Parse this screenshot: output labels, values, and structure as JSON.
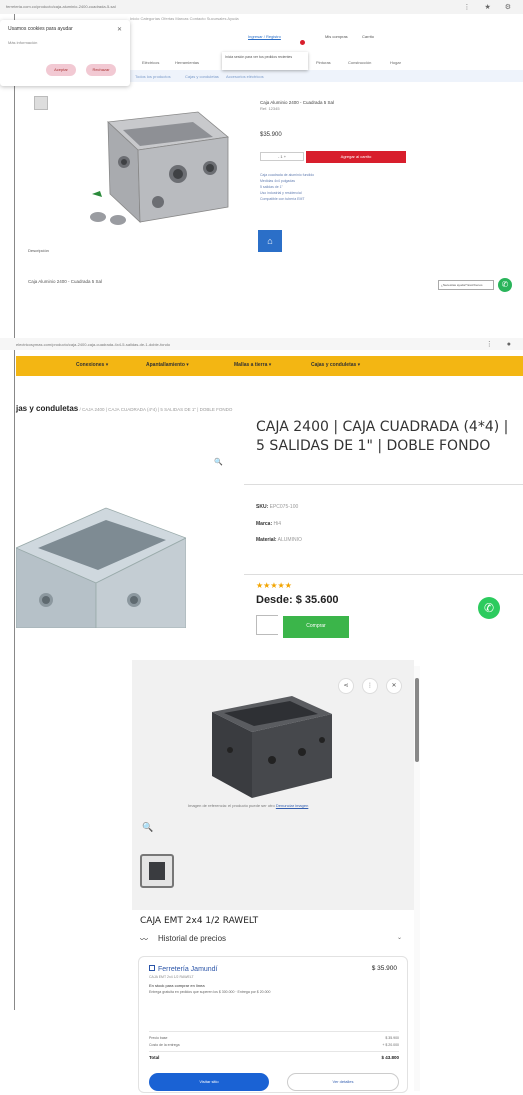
{
  "panel1": {
    "url": "ferreteria.com.co/producto/caja-aluminio-2400-cuadrada-5-sal",
    "window_controls": "⋮ ★ ⚙",
    "tabs": "Inicio   Categorías   Ofertas   Marcas   Contacto   Sucursales   Ayuda",
    "search_placeholder": "Buscar",
    "nav": [
      "Ingresar / Registro",
      "Mis compras",
      "Carrito"
    ],
    "categories": [
      "Eléctricos",
      "Herramientas",
      "Plomería",
      "Pinturas",
      "Construcción",
      "Hogar"
    ],
    "filter_links": [
      "Todos los productos",
      "Cajas y conduletas",
      "Accesorios eléctricos"
    ],
    "cookie": {
      "title": "Usamos cookies para ayudar",
      "sub": "Más información",
      "accept": "Aceptar",
      "reject": "Rechazar"
    },
    "tooltip": "Inicia sesión para ver tus pedidos recientes",
    "product_title": "Caja Aluminio 2400 - Cuadrada 5 Sal",
    "product_sub": "Ref. 12345",
    "price": "$35.900",
    "qty": "-   1   +",
    "add_to_cart": "Agregar al carrito",
    "features": [
      "Caja cuadrada de aluminio fundido",
      "Medidas 4x4 pulgadas",
      "5 salidas de 1\"",
      "Uso industrial y residencial",
      "Compatible con tubería EMT"
    ],
    "home_icon": "⌂",
    "section_label": "Descripción",
    "section_sub": "Caja Aluminio 2400 - Cuadrada 5 Sal",
    "chat_text": "¿Necesitas ayuda? Escríbenos"
  },
  "panel2": {
    "url": "electricosymas.com/producto/caja-2400-caja-cuadrada-4x4-5-salidas-de-1-doble-fondo",
    "window_controls": "⋮ ●",
    "nav": [
      "Conexiones ▾",
      "Apantallamiento ▾",
      "Mallas a tierra ▾",
      "Cajas y conduletas ▾"
    ],
    "breadcrumb_bold": "jas y conduletas",
    "breadcrumb_rest": " / CAJA 2400 | CAJA CUADRADA (4*4) | 5 SALIDAS DE 1\" | DOBLE FONDO",
    "title": "CAJA 2400 | CAJA CUADRADA (4*4) | 5 SALIDAS DE 1\" | DOBLE FONDO",
    "sku_label": "SKU:",
    "sku_value": " EPC075-100",
    "brand_label": "Marca:",
    "brand_value": " Hi4",
    "material_label": "Material:",
    "material_value": " ALUMINIO",
    "stars": "★★★★★",
    "price": "Desde: $ 35.600",
    "buy_label": "Comprar",
    "zoom_icon": "🔍"
  },
  "panel3": {
    "share_icon": "⋖",
    "more_icon": "⋮",
    "close_icon": "✕",
    "zoom_icon": "🔍",
    "note": "Imagen de referencia: el producto puede ser otro",
    "note_link": "Denunciar imagen",
    "product_title": "CAJA EMT 2x4 1/2 RAWELT",
    "history_label": "Historial de precios",
    "chevron": "⌄",
    "store_name": "Ferretería Jamundí",
    "store_price": "$ 35.900",
    "store_sub": "CAJA EMT 2x4 1/2 RAWELT",
    "stock": "En stock para comprar en línea",
    "delivery": "Entrega gratuita en pedidos que superen los $ 300.000 · Entrega por $ 20.000",
    "rows": [
      {
        "label": "Precio base",
        "value": "$ 35.900"
      },
      {
        "label": "Costo de la entrega",
        "value": "+ $ 20.000"
      }
    ],
    "total_label": "Total",
    "total_value": "$ 43.800",
    "visit": "Visitar sitio",
    "details": "Ver detalles"
  }
}
